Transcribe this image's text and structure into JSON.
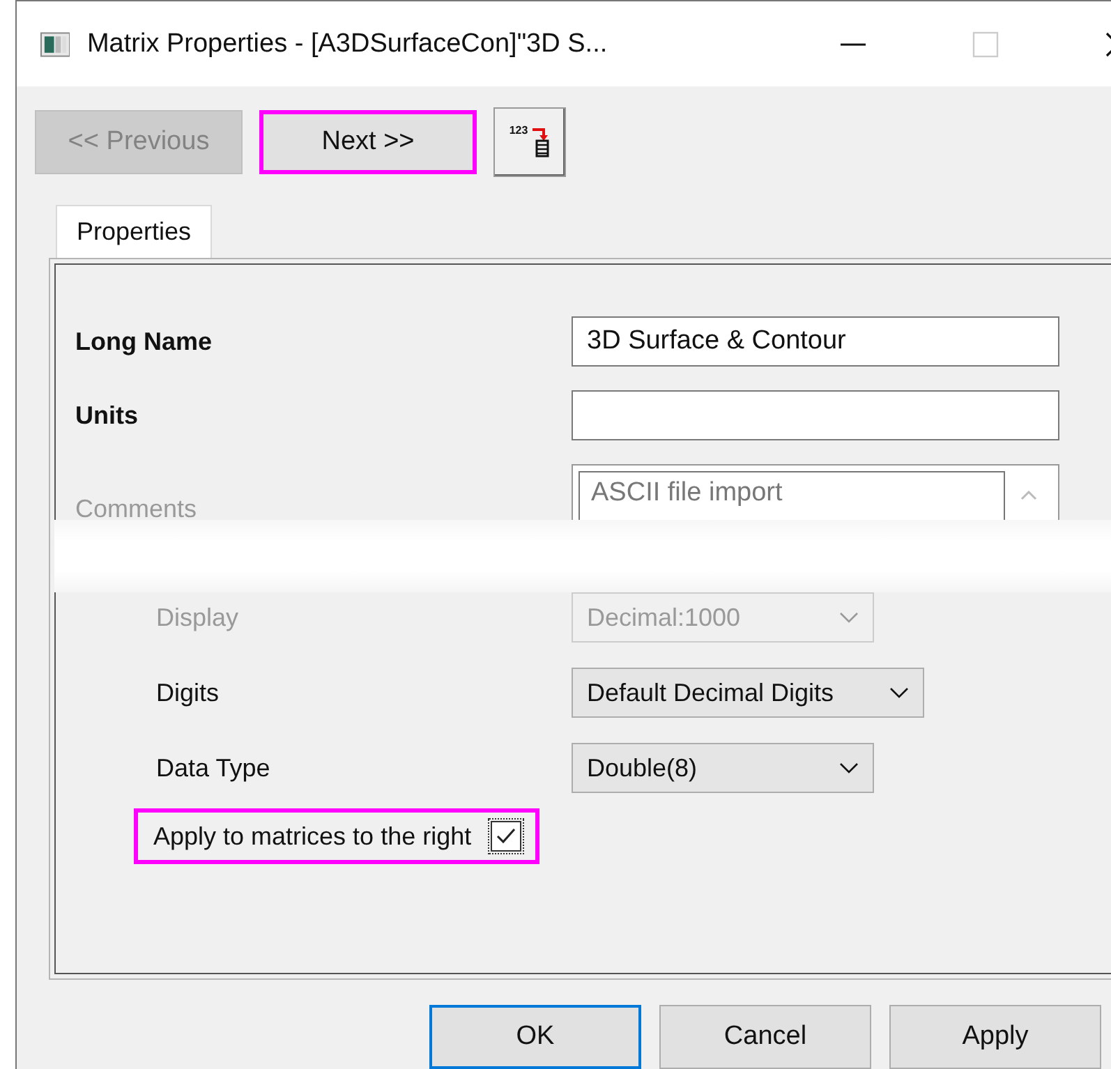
{
  "window": {
    "title": "Matrix Properties - [A3DSurfaceCon]\"3D S..."
  },
  "toolbar": {
    "buttons": [
      {
        "kind": "text",
        "label": "<< Previous",
        "disabled": true,
        "highlighted": false
      },
      {
        "kind": "text",
        "label": "Next >>",
        "disabled": false,
        "highlighted": true
      },
      {
        "kind": "icon",
        "label": "123",
        "disabled": false,
        "highlighted": false
      }
    ]
  },
  "tabs": [
    {
      "label": "Properties",
      "selected": true
    }
  ],
  "fields": [
    {
      "kind": "text",
      "label": "Long Name",
      "value": "3D Surface & Contour",
      "disabled": false
    },
    {
      "kind": "text",
      "label": "Units",
      "disabled": false
    },
    {
      "kind": "memo",
      "label": "Comments",
      "value": "ASCII file import",
      "disabled": true
    },
    {
      "kind": "combo",
      "label": "Display",
      "value": "Decimal:1000",
      "disabled": true
    },
    {
      "kind": "combo",
      "label": "Digits",
      "value": "Default Decimal Digits",
      "disabled": false
    },
    {
      "kind": "combo",
      "label": "Data Type",
      "value": "Double(8)",
      "disabled": false
    },
    {
      "kind": "check",
      "label": "Apply to matrices to the right",
      "checked": true,
      "highlighted": true
    }
  ],
  "buttons": [
    {
      "label": "OK",
      "default": true
    },
    {
      "label": "Cancel",
      "default": false
    },
    {
      "label": "Apply",
      "default": false
    }
  ]
}
